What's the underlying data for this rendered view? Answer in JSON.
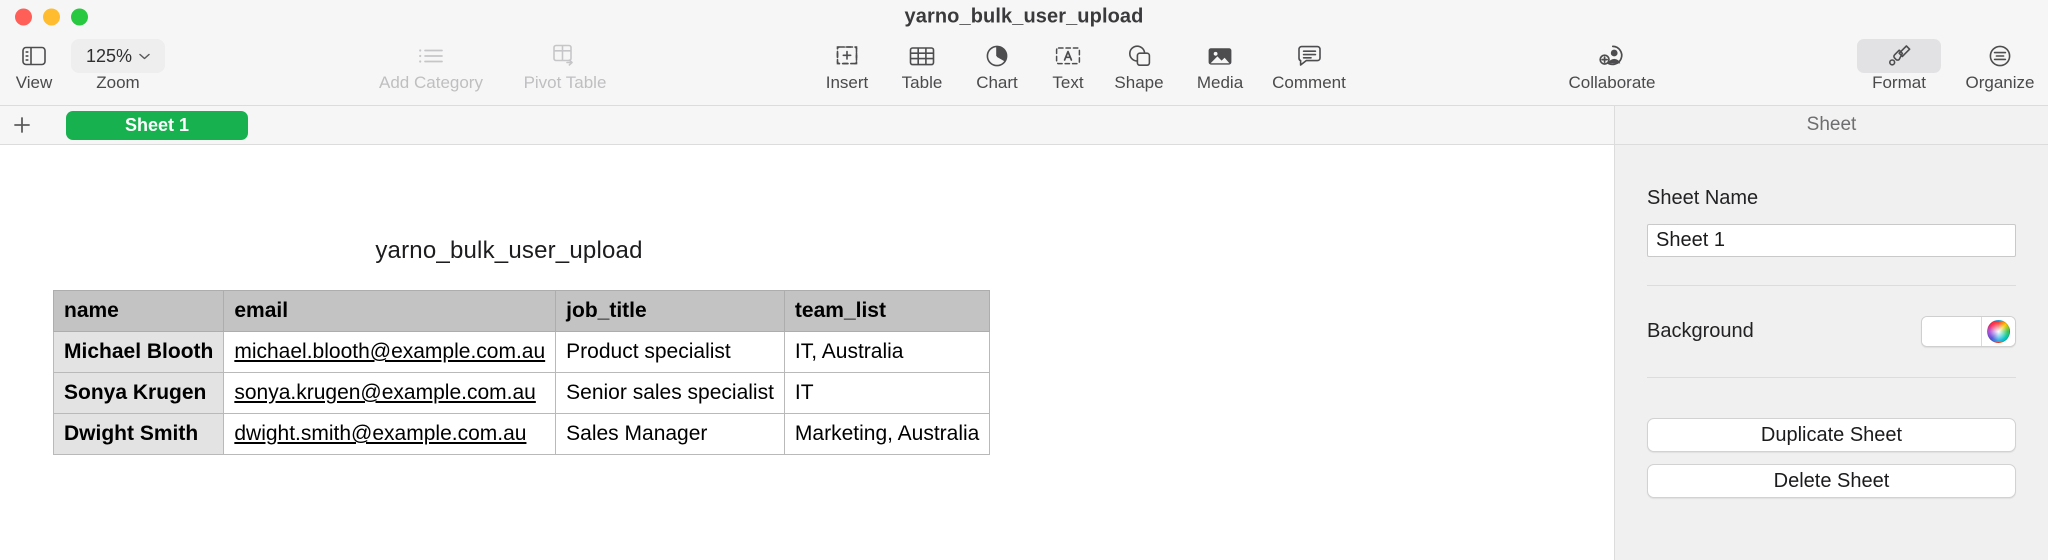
{
  "window": {
    "title": "yarno_bulk_user_upload",
    "traffic_lights": [
      {
        "name": "close",
        "color": "#ff5f57"
      },
      {
        "name": "minimize",
        "color": "#febc2e"
      },
      {
        "name": "maximize",
        "color": "#28c840"
      }
    ]
  },
  "toolbar": {
    "view": {
      "label": "View",
      "icon": "sidebar-icon"
    },
    "zoom": {
      "label": "Zoom",
      "value": "125%",
      "icon": "chevron-down-icon"
    },
    "items": [
      {
        "label": "Add Category",
        "icon": "list-bullet-icon",
        "disabled": true
      },
      {
        "label": "Pivot Table",
        "icon": "pivot-table-icon",
        "disabled": true
      },
      {
        "label": "Insert",
        "icon": "insert-icon",
        "disabled": false
      },
      {
        "label": "Table",
        "icon": "table-icon",
        "disabled": false
      },
      {
        "label": "Chart",
        "icon": "chart-pie-icon",
        "disabled": false
      },
      {
        "label": "Text",
        "icon": "text-box-icon",
        "disabled": false
      },
      {
        "label": "Shape",
        "icon": "shape-icon",
        "disabled": false
      },
      {
        "label": "Media",
        "icon": "media-image-icon",
        "disabled": false
      },
      {
        "label": "Comment",
        "icon": "comment-icon",
        "disabled": false
      },
      {
        "label": "Collaborate",
        "icon": "collaborate-person-icon",
        "disabled": false
      },
      {
        "label": "Format",
        "icon": "format-brush-icon",
        "disabled": false,
        "active": true
      },
      {
        "label": "Organize",
        "icon": "organize-icon",
        "disabled": false
      }
    ]
  },
  "tabbar": {
    "add_sheet_icon": "plus-icon",
    "sheets": [
      {
        "label": "Sheet 1",
        "active": true,
        "color": "#17b24f"
      }
    ]
  },
  "canvas": {
    "table_title": "yarno_bulk_user_upload",
    "table": {
      "headers": [
        "name",
        "email",
        "job_title",
        "team_list"
      ],
      "rows": [
        {
          "name": "Michael Blooth",
          "email": "michael.blooth@example.com.au",
          "job_title": "Product specialist",
          "team_list": "IT, Australia"
        },
        {
          "name": "Sonya Krugen",
          "email": "sonya.krugen@example.com.au",
          "job_title": "Senior sales specialist",
          "team_list": "IT"
        },
        {
          "name": "Dwight Smith",
          "email": "dwight.smith@example.com.au",
          "job_title": "Sales Manager",
          "team_list": "Marketing, Australia"
        }
      ]
    }
  },
  "panel": {
    "header": "Sheet",
    "sheet_name_label": "Sheet Name",
    "sheet_name_value": "Sheet 1",
    "sheet_name_placeholder": "Sheet Name",
    "background_label": "Background",
    "background_color": "#ffffff",
    "color_wheel_icon": "color-wheel-icon",
    "duplicate_button": "Duplicate Sheet",
    "delete_button": "Delete Sheet"
  }
}
